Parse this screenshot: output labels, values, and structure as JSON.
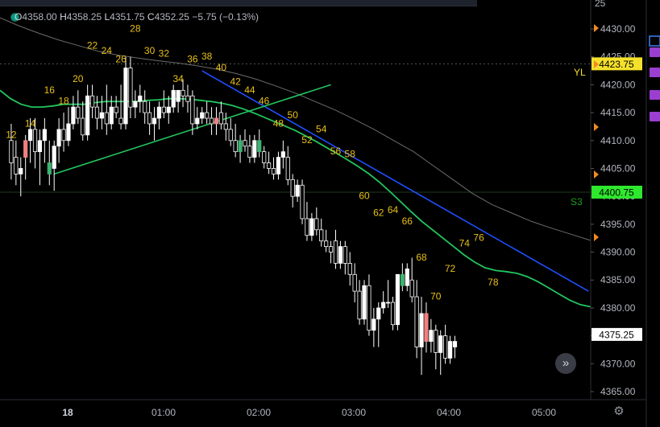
{
  "legend": {
    "open_label": "O",
    "open": "4358.00",
    "high_label": "H",
    "high": "4358.25",
    "low_label": "L",
    "low": "4351.75",
    "close_label": "C",
    "close": "4352.25",
    "change": "−5.75 (−0.13%)"
  },
  "colors": {
    "background": "#000000",
    "up_candle": "#ffffff",
    "down_candle": "#000000",
    "ema_line": "#22c55e",
    "sma_line": "#6b6b6b",
    "trendline_down": "#1e4fff",
    "trendline_up": "#22c55e",
    "bar_numbers": "#e8c01a",
    "price_tag_yellow": "#f5e12b",
    "price_tag_green": "#2ee82e",
    "price_tag_white": "#ffffff"
  },
  "chart_data": {
    "type": "candlestick",
    "x_labels": [
      "18",
      "01:00",
      "02:00",
      "03:00",
      "04:00",
      "05:00"
    ],
    "y_ticks": [
      4430,
      4425,
      4420,
      4415,
      4410,
      4405,
      4400,
      4395,
      4390,
      4385,
      4380,
      4375,
      4370,
      4365
    ],
    "y_tick_labels": [
      "4430.00",
      "4425.00",
      "4420.00",
      "4415.00",
      "4410.00",
      "4405.00",
      "4400.00",
      "4395.00",
      "4390.00",
      "4385.00",
      "4380.00",
      "4375.00",
      "4370.00",
      "4365.00"
    ],
    "ylim": [
      4364,
      4433
    ],
    "levels": [
      {
        "name": "YL",
        "price": 4423.75,
        "label": "4423.75",
        "style": "yellow"
      },
      {
        "name": "S3",
        "price": 4400.75,
        "label": "4400.75",
        "style": "green"
      }
    ],
    "last_price": {
      "price": 4375.25,
      "label": "4375.25"
    },
    "candles": [
      {
        "o": 4410,
        "h": 4413,
        "l": 4403,
        "c": 4406
      },
      {
        "o": 4407,
        "h": 4410,
        "l": 4402,
        "c": 4404
      },
      {
        "o": 4404,
        "h": 4407,
        "l": 4400,
        "c": 4405
      },
      {
        "o": 4407,
        "h": 4411,
        "l": 4403,
        "c": 4410
      },
      {
        "o": 4410,
        "h": 4414,
        "l": 4406,
        "c": 4412
      },
      {
        "o": 4412,
        "h": 4414,
        "l": 4405,
        "c": 4408
      },
      {
        "o": 4408,
        "h": 4412,
        "l": 4402,
        "c": 4410
      },
      {
        "o": 4410,
        "h": 4414,
        "l": 4406,
        "c": 4412
      },
      {
        "o": 4406,
        "h": 4410,
        "l": 4402,
        "c": 4404
      },
      {
        "o": 4405,
        "h": 4410,
        "l": 4401,
        "c": 4409
      },
      {
        "o": 4409,
        "h": 4414,
        "l": 4406,
        "c": 4412
      },
      {
        "o": 4412,
        "h": 4415,
        "l": 4408,
        "c": 4410
      },
      {
        "o": 4410,
        "h": 4416,
        "l": 4409,
        "c": 4413
      },
      {
        "o": 4413,
        "h": 4418,
        "l": 4412,
        "c": 4416
      },
      {
        "o": 4416,
        "h": 4419,
        "l": 4413,
        "c": 4414
      },
      {
        "o": 4414,
        "h": 4417,
        "l": 4410,
        "c": 4411
      },
      {
        "o": 4411,
        "h": 4420,
        "l": 4410,
        "c": 4418
      },
      {
        "o": 4418,
        "h": 4420,
        "l": 4414,
        "c": 4416
      },
      {
        "o": 4416,
        "h": 4418,
        "l": 4412,
        "c": 4414
      },
      {
        "o": 4414,
        "h": 4418,
        "l": 4412,
        "c": 4415
      },
      {
        "o": 4415,
        "h": 4420,
        "l": 4411,
        "c": 4413
      },
      {
        "o": 4413,
        "h": 4418,
        "l": 4412,
        "c": 4416
      },
      {
        "o": 4416,
        "h": 4418,
        "l": 4414,
        "c": 4415
      },
      {
        "o": 4414,
        "h": 4420,
        "l": 4412,
        "c": 4413
      },
      {
        "o": 4413,
        "h": 4425,
        "l": 4412,
        "c": 4423
      },
      {
        "o": 4423,
        "h": 4425,
        "l": 4414,
        "c": 4416
      },
      {
        "o": 4416,
        "h": 4419,
        "l": 4414,
        "c": 4417
      },
      {
        "o": 4417,
        "h": 4420,
        "l": 4415,
        "c": 4418
      },
      {
        "o": 4417,
        "h": 4419,
        "l": 4413,
        "c": 4415
      },
      {
        "o": 4415,
        "h": 4417,
        "l": 4411,
        "c": 4413
      },
      {
        "o": 4413,
        "h": 4416,
        "l": 4410,
        "c": 4414
      },
      {
        "o": 4414,
        "h": 4417,
        "l": 4412,
        "c": 4416
      },
      {
        "o": 4416,
        "h": 4419,
        "l": 4414,
        "c": 4415
      },
      {
        "o": 4415,
        "h": 4418,
        "l": 4413,
        "c": 4416
      },
      {
        "o": 4416,
        "h": 4420,
        "l": 4415,
        "c": 4419
      },
      {
        "o": 4417,
        "h": 4419,
        "l": 4415,
        "c": 4419
      },
      {
        "o": 4419,
        "h": 4421,
        "l": 4416,
        "c": 4418
      },
      {
        "o": 4418,
        "h": 4420,
        "l": 4415,
        "c": 4417
      },
      {
        "o": 4418,
        "h": 4419,
        "l": 4411,
        "c": 4413
      },
      {
        "o": 4413,
        "h": 4416,
        "l": 4412,
        "c": 4414
      },
      {
        "o": 4414,
        "h": 4416,
        "l": 4413,
        "c": 4415
      },
      {
        "o": 4415,
        "h": 4417,
        "l": 4413,
        "c": 4414
      },
      {
        "o": 4414,
        "h": 4416,
        "l": 4411,
        "c": 4413
      },
      {
        "o": 4413,
        "h": 4416,
        "l": 4411,
        "c": 4414
      },
      {
        "o": 4415,
        "h": 4417,
        "l": 4412,
        "c": 4413
      },
      {
        "o": 4413,
        "h": 4415,
        "l": 4410,
        "c": 4412
      },
      {
        "o": 4412,
        "h": 4414,
        "l": 4409,
        "c": 4410
      },
      {
        "o": 4410,
        "h": 4413,
        "l": 4407,
        "c": 4408
      },
      {
        "o": 4408,
        "h": 4411,
        "l": 4406,
        "c": 4410
      },
      {
        "o": 4410,
        "h": 4412,
        "l": 4408,
        "c": 4409
      },
      {
        "o": 4409,
        "h": 4411,
        "l": 4406,
        "c": 4407
      },
      {
        "o": 4407,
        "h": 4411,
        "l": 4406,
        "c": 4410
      },
      {
        "o": 4410,
        "h": 4412,
        "l": 4407,
        "c": 4408
      },
      {
        "o": 4408,
        "h": 4409,
        "l": 4405,
        "c": 4406
      },
      {
        "o": 4406,
        "h": 4408,
        "l": 4404,
        "c": 4405
      },
      {
        "o": 4405,
        "h": 4407,
        "l": 4403,
        "c": 4404
      },
      {
        "o": 4404,
        "h": 4408,
        "l": 4403,
        "c": 4407
      },
      {
        "o": 4407,
        "h": 4410,
        "l": 4405,
        "c": 4408
      },
      {
        "o": 4407,
        "h": 4409,
        "l": 4402,
        "c": 4403
      },
      {
        "o": 4403,
        "h": 4404,
        "l": 4398,
        "c": 4400
      },
      {
        "o": 4400,
        "h": 4403,
        "l": 4399,
        "c": 4402
      },
      {
        "o": 4402,
        "h": 4403,
        "l": 4395,
        "c": 4396
      },
      {
        "o": 4396,
        "h": 4399,
        "l": 4392,
        "c": 4393
      },
      {
        "o": 4393,
        "h": 4397,
        "l": 4392,
        "c": 4396
      },
      {
        "o": 4396,
        "h": 4398,
        "l": 4393,
        "c": 4394
      },
      {
        "o": 4394,
        "h": 4396,
        "l": 4391,
        "c": 4392
      },
      {
        "o": 4392,
        "h": 4394,
        "l": 4390,
        "c": 4391
      },
      {
        "o": 4391,
        "h": 4392,
        "l": 4388,
        "c": 4390
      },
      {
        "o": 4392,
        "h": 4394,
        "l": 4387,
        "c": 4388
      },
      {
        "o": 4388,
        "h": 4392,
        "l": 4387,
        "c": 4391
      },
      {
        "o": 4391,
        "h": 4392,
        "l": 4386,
        "c": 4388
      },
      {
        "o": 4388,
        "h": 4390,
        "l": 4384,
        "c": 4386
      },
      {
        "o": 4386,
        "h": 4388,
        "l": 4381,
        "c": 4383
      },
      {
        "o": 4383,
        "h": 4385,
        "l": 4377,
        "c": 4378
      },
      {
        "o": 4378,
        "h": 4385,
        "l": 4377,
        "c": 4384
      },
      {
        "o": 4384,
        "h": 4386,
        "l": 4375,
        "c": 4376
      },
      {
        "o": 4376,
        "h": 4380,
        "l": 4373,
        "c": 4378
      },
      {
        "o": 4378,
        "h": 4381,
        "l": 4373,
        "c": 4380
      },
      {
        "o": 4380,
        "h": 4383,
        "l": 4379,
        "c": 4381
      },
      {
        "o": 4381,
        "h": 4385,
        "l": 4380,
        "c": 4381
      },
      {
        "o": 4381,
        "h": 4382,
        "l": 4376,
        "c": 4377
      },
      {
        "o": 4377,
        "h": 4386,
        "l": 4376,
        "c": 4386
      },
      {
        "o": 4386,
        "h": 4388,
        "l": 4383,
        "c": 4384
      },
      {
        "o": 4384,
        "h": 4388,
        "l": 4383,
        "c": 4387
      },
      {
        "o": 4385,
        "h": 4389,
        "l": 4381,
        "c": 4382
      },
      {
        "o": 4382,
        "h": 4385,
        "l": 4371,
        "c": 4373
      },
      {
        "o": 4373,
        "h": 4382,
        "l": 4368,
        "c": 4379
      },
      {
        "o": 4379,
        "h": 4381,
        "l": 4372,
        "c": 4374
      },
      {
        "o": 4374,
        "h": 4378,
        "l": 4372,
        "c": 4376
      },
      {
        "o": 4376,
        "h": 4377,
        "l": 4369,
        "c": 4372
      },
      {
        "o": 4372,
        "h": 4376,
        "l": 4368,
        "c": 4375
      },
      {
        "o": 4375,
        "h": 4377,
        "l": 4370,
        "c": 4371
      },
      {
        "o": 4371,
        "h": 4375,
        "l": 4370,
        "c": 4374
      },
      {
        "o": 4373,
        "h": 4375,
        "l": 4371,
        "c": 4374
      }
    ],
    "bar_number_labels": [
      {
        "text": "12",
        "bar": 1,
        "price": 4410.5
      },
      {
        "text": "14",
        "bar": 5,
        "price": 4412.5
      },
      {
        "text": "16",
        "bar": 9,
        "price": 4418.5
      },
      {
        "text": "18",
        "bar": 12,
        "price": 4416.5
      },
      {
        "text": "20",
        "bar": 15,
        "price": 4420.5
      },
      {
        "text": "22",
        "bar": 18,
        "price": 4426.5
      },
      {
        "text": "24",
        "bar": 21,
        "price": 4425.5
      },
      {
        "text": "26",
        "bar": 24,
        "price": 4424.0
      },
      {
        "text": "28",
        "bar": 27,
        "price": 4429.5
      },
      {
        "text": "30",
        "bar": 30,
        "price": 4425.5
      },
      {
        "text": "32",
        "bar": 33,
        "price": 4425.0
      },
      {
        "text": "34",
        "bar": 36,
        "price": 4420.5
      },
      {
        "text": "36",
        "bar": 39,
        "price": 4424.0
      },
      {
        "text": "38",
        "bar": 42,
        "price": 4424.5
      },
      {
        "text": "40",
        "bar": 45,
        "price": 4422.5
      },
      {
        "text": "42",
        "bar": 48,
        "price": 4420.0
      },
      {
        "text": "44",
        "bar": 51,
        "price": 4418.5
      },
      {
        "text": "46",
        "bar": 54,
        "price": 4416.5
      },
      {
        "text": "48",
        "bar": 57,
        "price": 4412.5
      },
      {
        "text": "50",
        "bar": 60,
        "price": 4414.0
      },
      {
        "text": "52",
        "bar": 63,
        "price": 4409.5
      },
      {
        "text": "54",
        "bar": 66,
        "price": 4411.5
      },
      {
        "text": "56",
        "bar": 69,
        "price": 4407.5
      },
      {
        "text": "58",
        "bar": 72,
        "price": 4407.0
      },
      {
        "text": "60",
        "bar": 75,
        "price": 4399.5
      },
      {
        "text": "62",
        "bar": 78,
        "price": 4396.5
      },
      {
        "text": "64",
        "bar": 81,
        "price": 4397.0
      },
      {
        "text": "66",
        "bar": 84,
        "price": 4395.0
      },
      {
        "text": "68",
        "bar": 87,
        "price": 4388.5
      },
      {
        "text": "70",
        "bar": 90,
        "price": 4381.5
      },
      {
        "text": "72",
        "bar": 93,
        "price": 4386.5
      },
      {
        "text": "74",
        "bar": 96,
        "price": 4391.0
      },
      {
        "text": "76",
        "bar": 99,
        "price": 4392.0
      },
      {
        "text": "78",
        "bar": 102,
        "price": 4384.0
      }
    ],
    "ema": [
      4419,
      4417.5,
      4416.5,
      4416,
      4416,
      4416.2,
      4416.5,
      4416.5,
      4416.5,
      4416.8,
      4417,
      4417,
      4417,
      4417,
      4417.2,
      4417.3,
      4417.5,
      4417.5,
      4417.4,
      4417.2,
      4417,
      4416.7,
      4416.3,
      4415.7,
      4415,
      4414.2,
      4413.4,
      4412.6,
      4411.8,
      4410.8,
      4409.8,
      4408.7,
      4407.6,
      4406.5,
      4405.3,
      4404,
      4402.5,
      4400.8,
      4399,
      4397.2,
      4395.5,
      4394,
      4392.5,
      4391,
      4389.5,
      4388.2,
      4387.2,
      4386.7,
      4386.5,
      4386.2,
      4385.6,
      4384.7,
      4383.6,
      4382.5,
      4381.4,
      4380.6,
      4380.2
    ],
    "sma": [
      4432,
      4430.5,
      4429.2,
      4428,
      4427,
      4426,
      4425.3,
      4424.8,
      4424.3,
      4423.9,
      4423.4,
      4422.8,
      4422,
      4421,
      4419.8,
      4418.5,
      4417,
      4415.5,
      4413.8,
      4412,
      4410,
      4408,
      4405.5,
      4403,
      4400.5,
      4398.5,
      4397,
      4395.5,
      4394.3,
      4393.2,
      4392.1
    ],
    "trendline_down": {
      "from": {
        "bar": 41,
        "price": 4422.5
      },
      "to": {
        "bar": 122,
        "price": 4383.0
      }
    },
    "trendline_up": {
      "from": {
        "bar": 10,
        "price": 4404.0
      },
      "to": {
        "bar": 68,
        "price": 4420.0
      }
    }
  },
  "right_markers": {
    "yl_label": "YL",
    "s3_label": "S3",
    "partial_top": "25"
  },
  "nav_button": "»"
}
